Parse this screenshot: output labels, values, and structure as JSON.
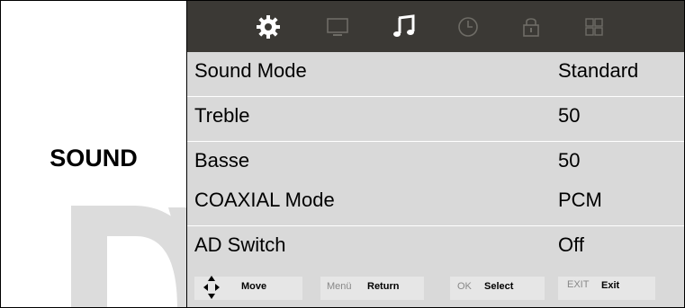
{
  "section_title": "SOUND",
  "watermark_text": "DY",
  "top_icons": [
    {
      "name": "settings-gear-icon",
      "active": false
    },
    {
      "name": "monitor-icon",
      "active": false
    },
    {
      "name": "music-note-icon",
      "active": true
    },
    {
      "name": "clock-icon",
      "active": false
    },
    {
      "name": "lock-icon",
      "active": false
    },
    {
      "name": "apps-grid-icon",
      "active": false
    }
  ],
  "menu": [
    {
      "label": "Sound Mode",
      "value": "Standard"
    },
    {
      "label": "Treble",
      "value": "50"
    },
    {
      "label": "Basse",
      "value": "50"
    },
    {
      "label": "COAXIAL Mode",
      "value": "PCM"
    },
    {
      "label": "AD Switch",
      "value": "Off"
    }
  ],
  "help": {
    "move_label": "Move",
    "menu_key": "Menü",
    "return_label": "Return",
    "ok_key": "OK",
    "select_label": "Select",
    "exit_key": "EXIT",
    "exit_label": "Exit"
  },
  "colors": {
    "icon_bar": "#3b3935",
    "menu_row": "#d9d9d9",
    "icon_active": "#ffffff",
    "icon_inactive": "#6e6c66"
  }
}
